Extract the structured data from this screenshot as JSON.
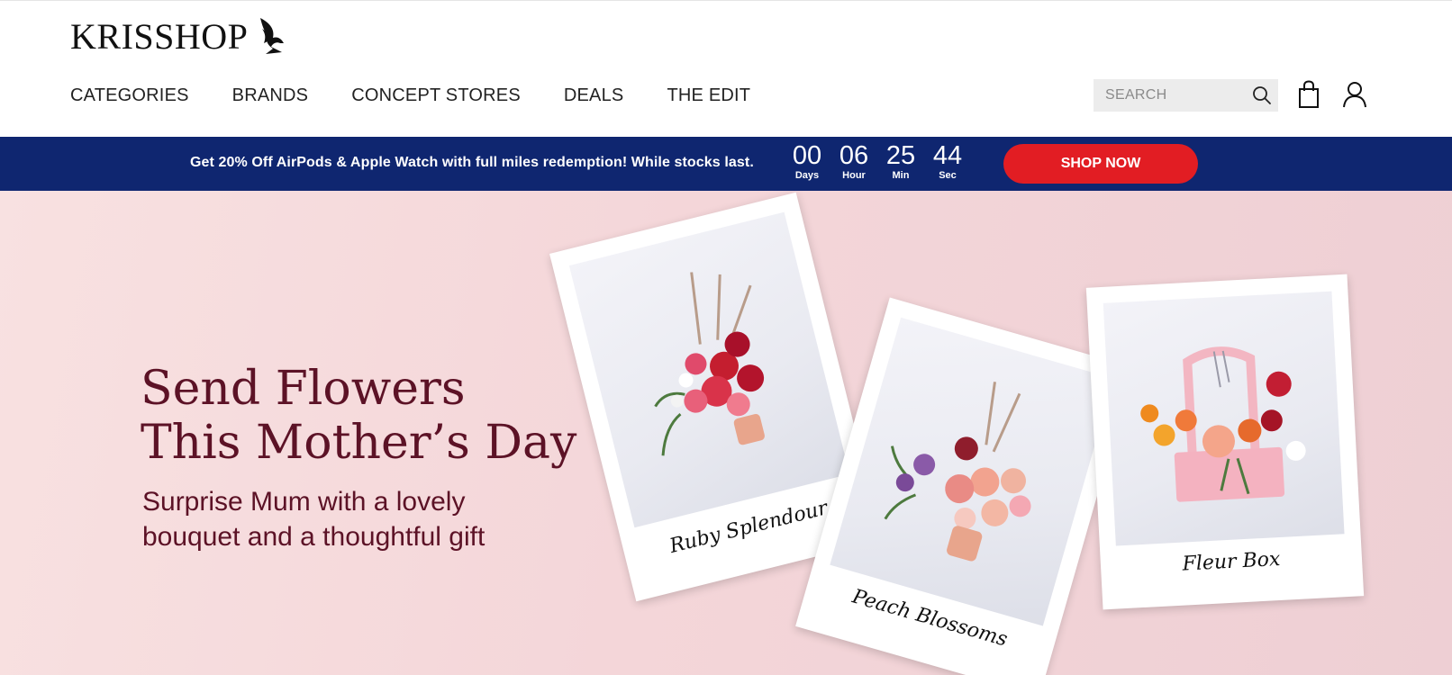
{
  "header": {
    "logo_text": "KRISSHOP",
    "nav": [
      "CATEGORIES",
      "BRANDS",
      "CONCEPT STORES",
      "DEALS",
      "THE EDIT"
    ],
    "search_placeholder": "SEARCH",
    "icons": [
      "search-icon",
      "shopping-bag-icon",
      "user-icon",
      "logo-bird-icon"
    ]
  },
  "promo": {
    "text": "Get 20% Off AirPods & Apple Watch with full miles redemption! While stocks last.",
    "countdown": [
      {
        "value": "00",
        "label": "Days"
      },
      {
        "value": "06",
        "label": "Hour"
      },
      {
        "value": "25",
        "label": "Min"
      },
      {
        "value": "44",
        "label": "Sec"
      }
    ],
    "button": "SHOP NOW"
  },
  "hero": {
    "title_lines": [
      "Send Flowers",
      "This Mother’s Day"
    ],
    "subtitle_lines": [
      "Surprise Mum with a lovely",
      "bouquet and a thoughtful gift"
    ],
    "cards": [
      {
        "caption": "Ruby Splendour"
      },
      {
        "caption": "Peach Blossoms"
      },
      {
        "caption": "Fleur Box"
      }
    ]
  },
  "colors": {
    "promo_bg": "#0f2670",
    "shop_now": "#e21d23",
    "hero_text": "#5c1226",
    "hero_bg": "#f4d6d9"
  }
}
